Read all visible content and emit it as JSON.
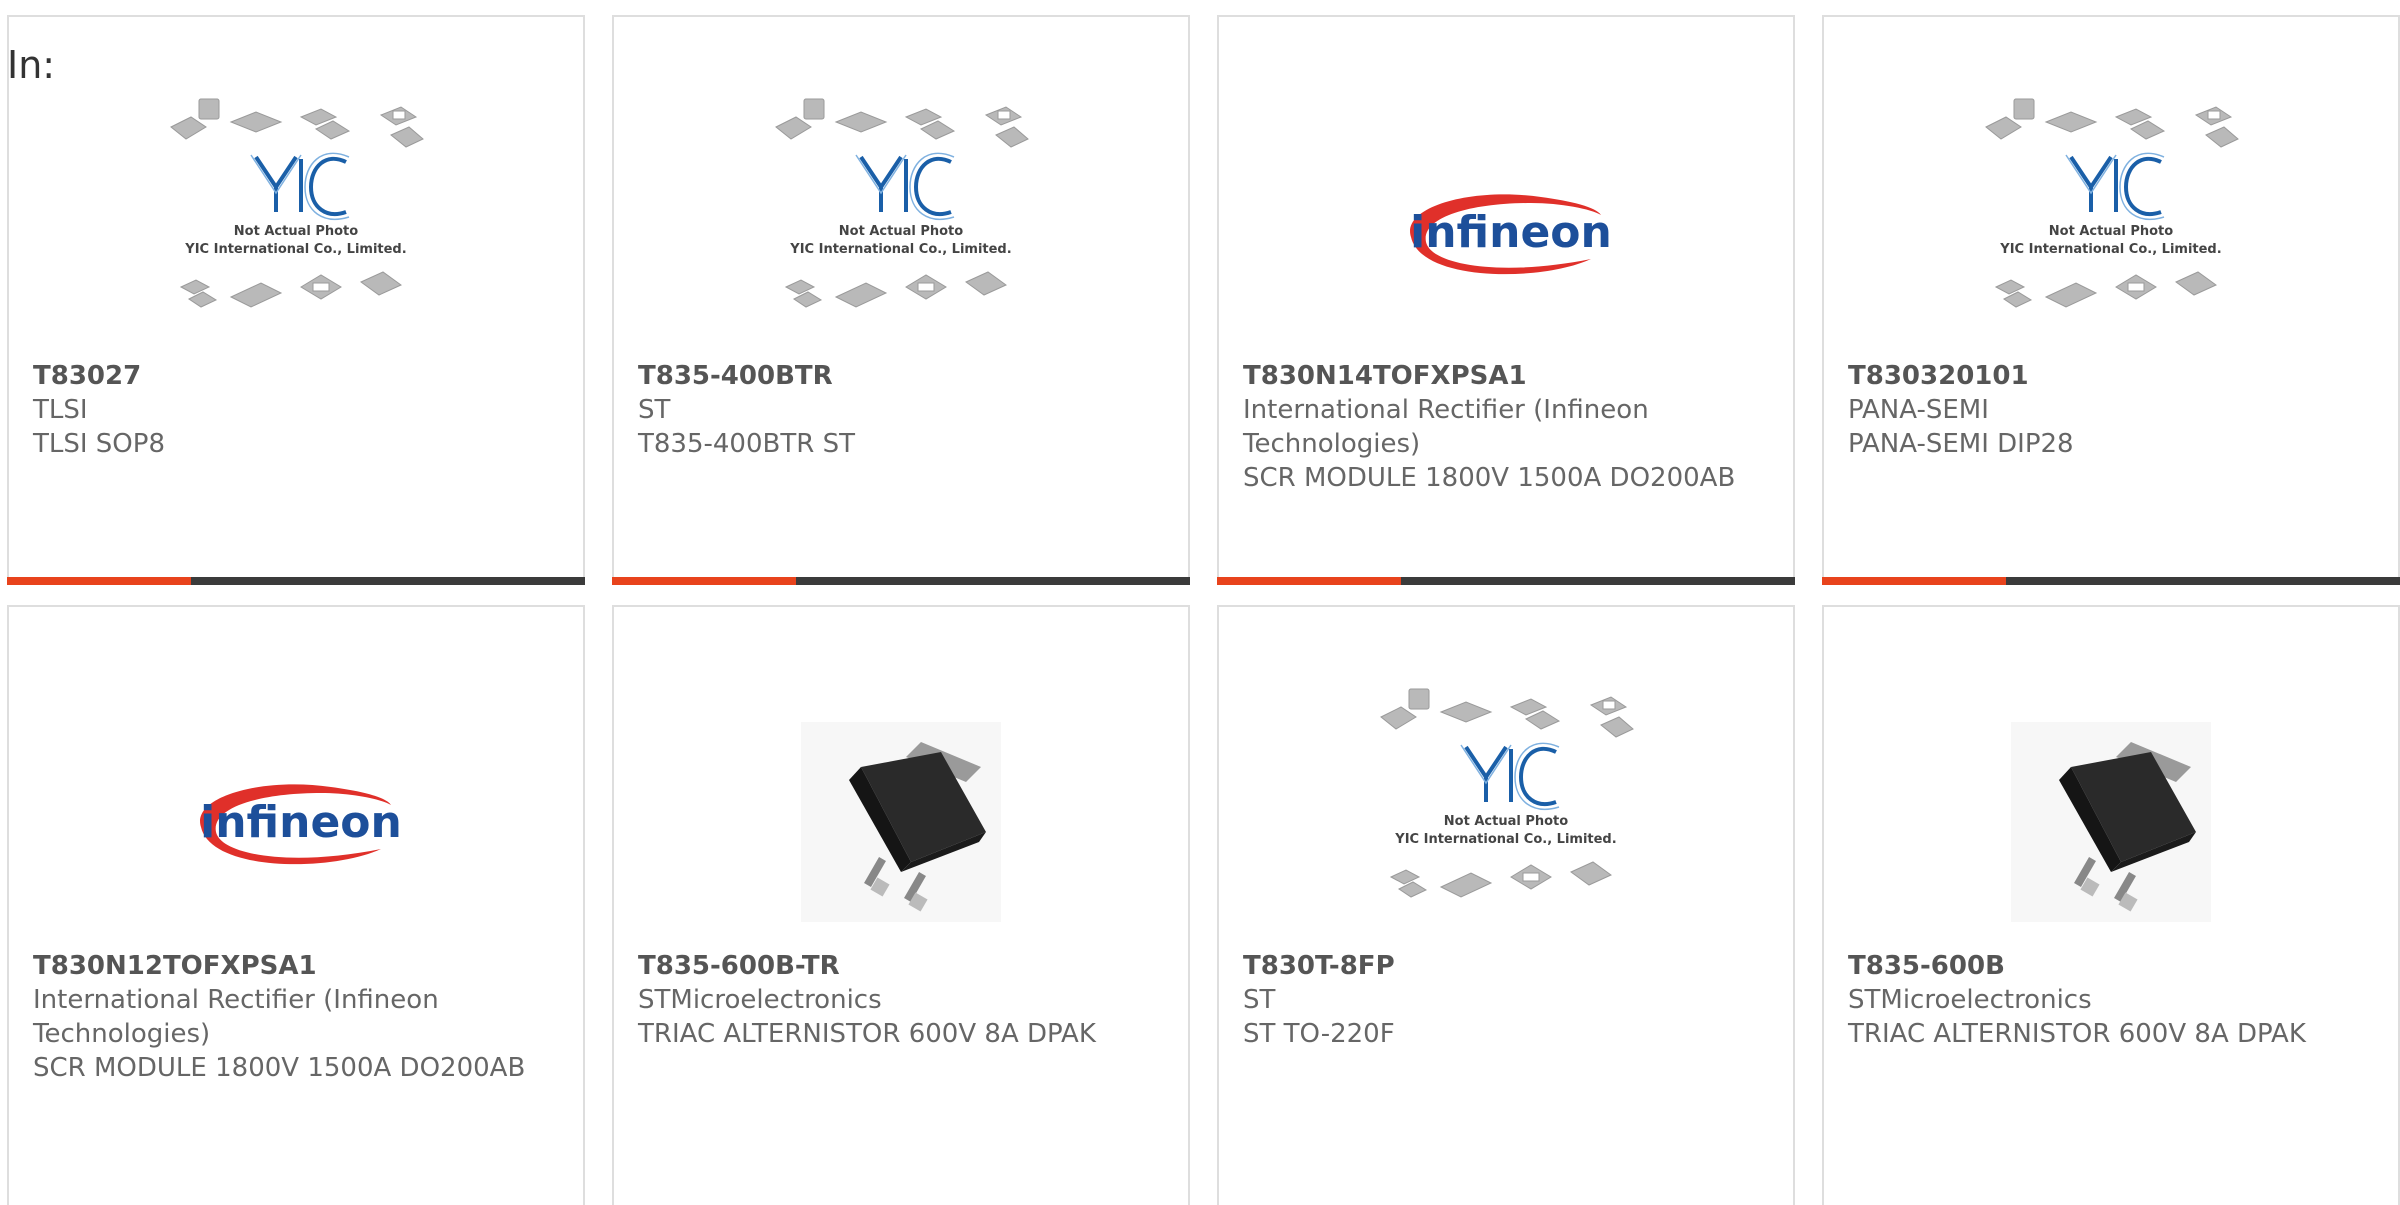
{
  "filter_label": "In:",
  "placeholder": {
    "line1": "Not Actual Photo",
    "line2": "YIC International Co., Limited.",
    "logo_text": "YIC"
  },
  "infineon_logo_text": "infineon",
  "colors": {
    "accent": "#e8431c",
    "bar": "#3b3b3b",
    "yic_blue": "#1a5fa8",
    "infineon_red": "#e0302a",
    "infineon_blue": "#1d4f9a"
  },
  "products": [
    {
      "part": "T83027",
      "maker": "TLSI",
      "desc": "TLSI SOP8",
      "image": "yic-placeholder"
    },
    {
      "part": "T835-400BTR",
      "maker": "ST",
      "desc": "T835-400BTR ST",
      "image": "yic-placeholder"
    },
    {
      "part": "T830N14TOFXPSA1",
      "maker": "International Rectifier (Infineon Technologies)",
      "desc": "SCR MODULE 1800V 1500A DO200AB",
      "image": "infineon-logo"
    },
    {
      "part": "T830320101",
      "maker": "PANA-SEMI",
      "desc": "PANA-SEMI DIP28",
      "image": "yic-placeholder"
    },
    {
      "part": "T830N12TOFXPSA1",
      "maker": "International Rectifier (Infineon Technologies)",
      "desc": "SCR MODULE 1800V 1500A DO200AB",
      "image": "infineon-logo"
    },
    {
      "part": "T835-600B-TR",
      "maker": "STMicroelectronics",
      "desc": "TRIAC ALTERNISTOR 600V 8A DPAK",
      "image": "dpak-photo"
    },
    {
      "part": "T830T-8FP",
      "maker": "ST",
      "desc": "ST TO-220F",
      "image": "yic-placeholder"
    },
    {
      "part": "T835-600B",
      "maker": "STMicroelectronics",
      "desc": "TRIAC ALTERNISTOR 600V 8A DPAK",
      "image": "dpak-photo"
    }
  ]
}
